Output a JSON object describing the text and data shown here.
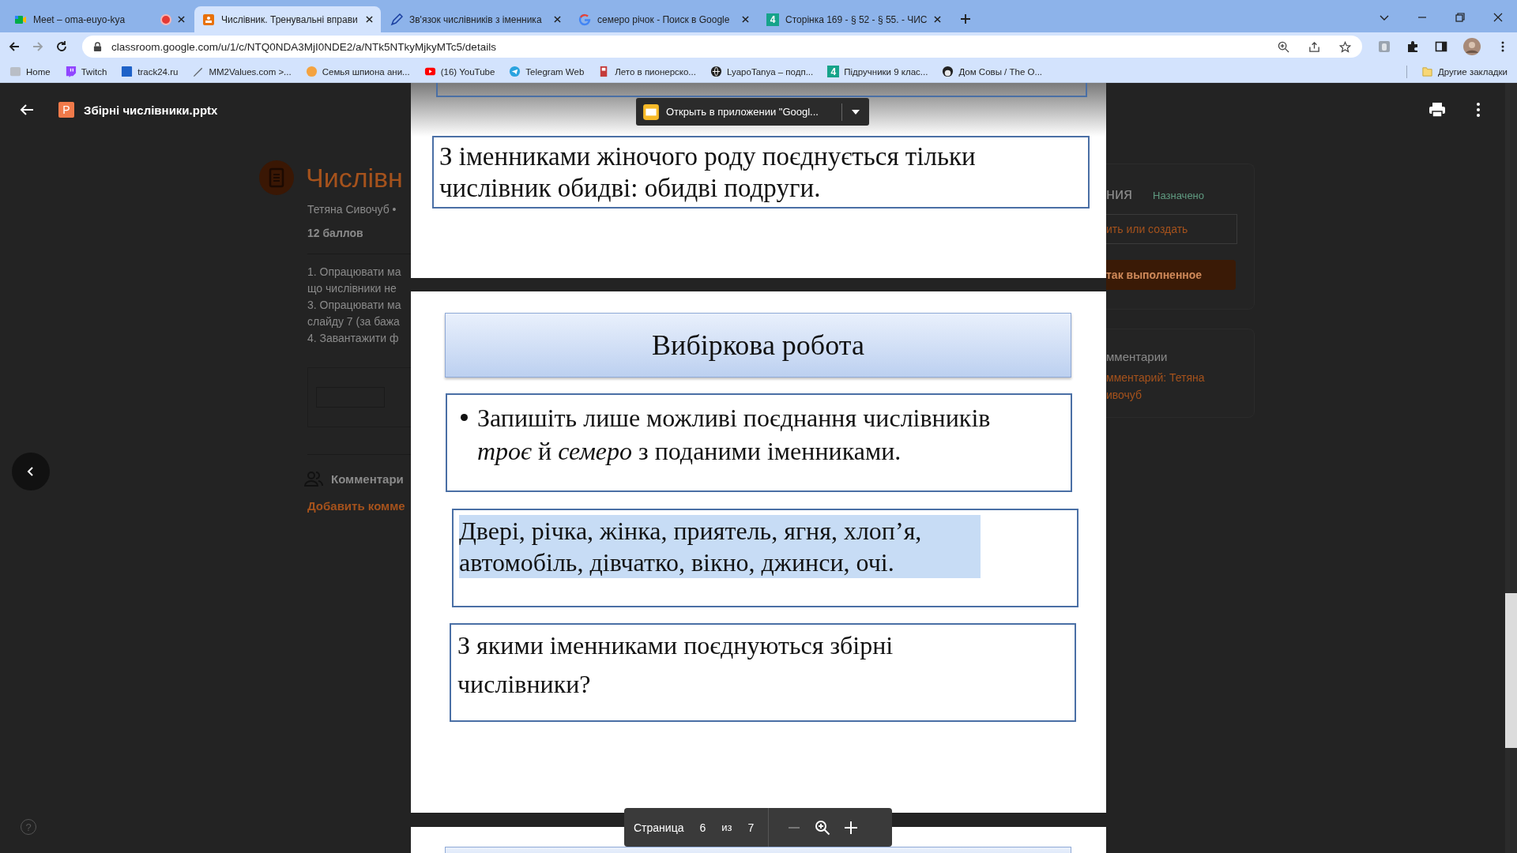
{
  "browser": {
    "tabs": [
      {
        "title": "Meet – oma-euyo-kya",
        "kind": "meet",
        "selected": false,
        "recording": true
      },
      {
        "title": "Числівник. Тренувальні вправи",
        "kind": "slides",
        "selected": true,
        "recording": false
      },
      {
        "title": "Зв'язок числівників з іменника",
        "kind": "pen",
        "selected": false,
        "recording": false
      },
      {
        "title": "семеро річок - Поиск в Google",
        "kind": "google",
        "selected": false,
        "recording": false
      },
      {
        "title": "Сторінка 169 - § 52 - § 55. - ЧИС",
        "kind": "badge",
        "badge": "4",
        "selected": false,
        "recording": false
      }
    ],
    "nav": [
      {
        "kind": "back",
        "disabled": false
      },
      {
        "kind": "forward",
        "disabled": true
      },
      {
        "kind": "reload",
        "disabled": false
      }
    ],
    "url": "classroom.google.com/u/1/c/NTQ0NDA3MjI0NDE2/a/NTk5NTkyMjkyMTc5/details",
    "bookmarks": [
      {
        "label": "Home",
        "kind": "home"
      },
      {
        "label": "Twitch",
        "kind": "twitch"
      },
      {
        "label": "track24.ru",
        "kind": "square"
      },
      {
        "label": "MM2Values.com >...",
        "kind": "blade"
      },
      {
        "label": "Семья шпиона ани...",
        "kind": "circle"
      },
      {
        "label": "(16) YouTube",
        "kind": "play"
      },
      {
        "label": "Telegram Web",
        "kind": "plane"
      },
      {
        "label": "Лето в пионерско...",
        "kind": "book"
      },
      {
        "label": "LyapoTanya – подп...",
        "kind": "globe"
      },
      {
        "label": "Підручники 9 клас...",
        "kind": "badge",
        "badge": "4"
      },
      {
        "label": "Дом Совы / The O...",
        "kind": "dark"
      }
    ],
    "other_bookmarks": "Другие закладки"
  },
  "background_page": {
    "left": {
      "title": "Числівн",
      "author": "Тетяна Сивочуб •",
      "points": "12 баллов",
      "instructions": [
        "1. Опрацювати ма",
        "що числівники не",
        "3. Опрацювати ма",
        "слайду 7 (за бажа",
        "4. Завантажити ф"
      ],
      "comments": "Комментари",
      "add_comment": "Добавить комме"
    },
    "right": {
      "heading": "ния",
      "status": "Назначено",
      "add_button": "ить или создать",
      "done_button": "так выполненное",
      "comments_heading": "мментарии",
      "comment_link": [
        "мментарий: Тетяна",
        "ивочуб"
      ]
    }
  },
  "viewer": {
    "file_badge": "P",
    "file_name": "Збірні числівники.pptx",
    "open_in_app": "Открыть в приложении \"Googl...",
    "help": "?",
    "slides": {
      "previous_note": "З іменниками жіночого роду поєднується тільки числівник обидві: обидві подруги.",
      "title": "Вибіркова робота",
      "task": "Запишіть лише можливі поєднання числівників *троє* й *семеро* з поданими іменниками.",
      "words": "Двері, річка, жінка, приятель, ягня, хлоп’я, автомобіль, дівчатко, вікно, джинси, очі.",
      "words_selected": true,
      "question": "З якими іменниками поєднуються збірні числівники?"
    },
    "toolbar": {
      "page_label": "Страница",
      "page": "6",
      "of": "из",
      "total": "7",
      "zoom": [
        {
          "kind": "zoom-out",
          "disabled": true
        },
        {
          "kind": "zoom-reset",
          "disabled": false
        },
        {
          "kind": "zoom-in",
          "disabled": false
        }
      ]
    }
  }
}
